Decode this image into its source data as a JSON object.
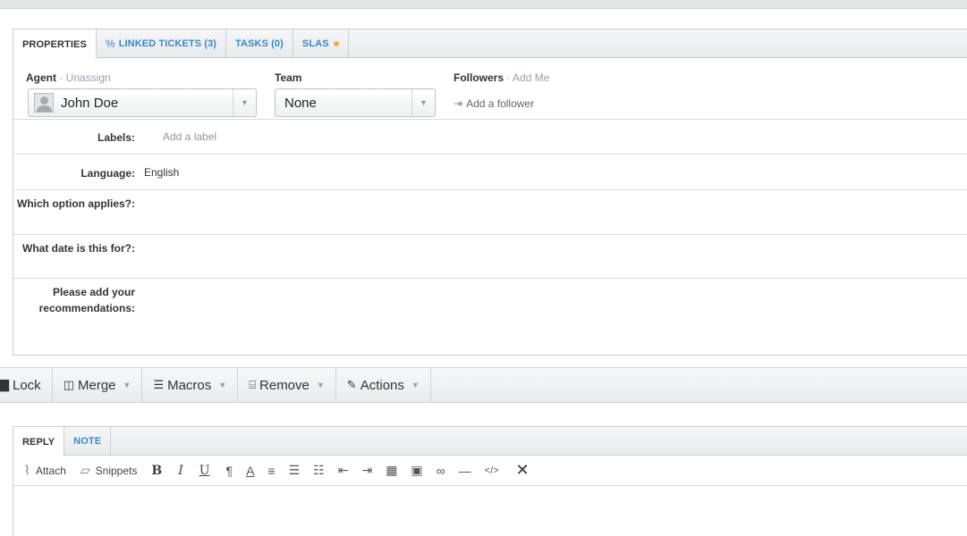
{
  "tabs": [
    {
      "label": "PROPERTIES",
      "glyph": ""
    },
    {
      "label": "LINKED TICKETS (3)",
      "glyph": "%"
    },
    {
      "label": "TASKS (0)",
      "glyph": ""
    },
    {
      "label": "SLAS",
      "glyph": ""
    }
  ],
  "agent": {
    "label": "Agent",
    "sep": " · ",
    "action": "Unassign",
    "value": "John Doe"
  },
  "team": {
    "label": "Team",
    "value": "None"
  },
  "followers": {
    "label": "Followers",
    "sep": " · ",
    "action": "Add Me",
    "add_label": "Add a follower",
    "add_icon": "⇥"
  },
  "fields": [
    {
      "label": "Labels:",
      "value": "Add a label"
    },
    {
      "label": "Language:",
      "value": "English"
    },
    {
      "label": "Which option applies?:",
      "value": ""
    },
    {
      "label": "What date is this for?:",
      "value": ""
    },
    {
      "label": "Please add your recommendations:",
      "value": ""
    }
  ],
  "toolbar": [
    {
      "label": "Lock",
      "glyph": "🔒"
    },
    {
      "label": "Merge",
      "glyph": "◫"
    },
    {
      "label": "Macros",
      "glyph": "☰"
    },
    {
      "label": "Remove",
      "glyph": "🗑"
    },
    {
      "label": "Actions",
      "glyph": "✎"
    }
  ],
  "reply_tabs": [
    "REPLY",
    "NOTE"
  ],
  "editor": {
    "attach": "Attach",
    "snippets": "Snippets",
    "bold": "B",
    "italic": "I",
    "underline": "U",
    "paragraph": "¶",
    "color": "A",
    "code": "</>",
    "close": "✕"
  },
  "colors": {
    "link": "#3a87c8",
    "sla_dot": "#f0ad4e"
  }
}
